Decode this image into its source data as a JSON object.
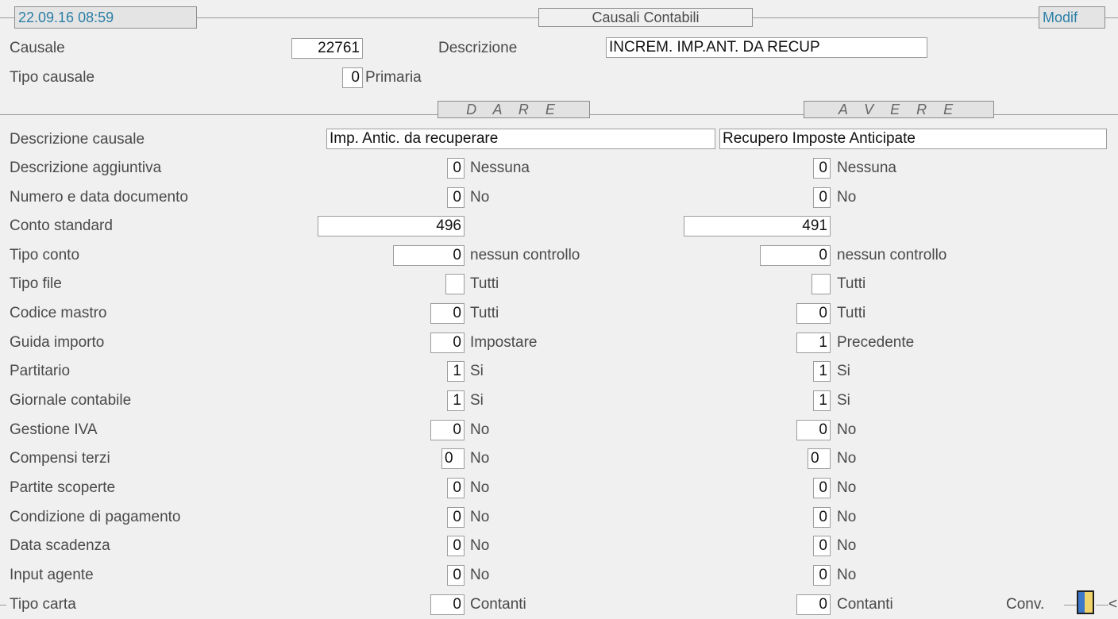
{
  "header": {
    "datetime": "22.09.16 08:59",
    "title": "Causali Contabili",
    "mode": "Modif"
  },
  "causale": {
    "label": "Causale",
    "value": "22761",
    "descrizione_label": "Descrizione",
    "descrizione_value": "INCREM. IMP.ANT. DA RECUP"
  },
  "tipo_causale": {
    "label": "Tipo causale",
    "value": "0",
    "desc": "Primaria"
  },
  "columns": {
    "dare": "D A R E",
    "avere": "A V E R E"
  },
  "rows": {
    "descrizione_causale": {
      "label": "Descrizione causale",
      "dare": "Imp. Antic. da recuperare",
      "avere": "Recupero Imposte Anticipate"
    },
    "descrizione_aggiuntiva": {
      "label": "Descrizione aggiuntiva",
      "dare_value": "0",
      "dare_desc": "Nessuna",
      "avere_value": "0",
      "avere_desc": "Nessuna"
    },
    "numero_data_documento": {
      "label": "Numero e data documento",
      "dare_value": "0",
      "dare_desc": "No",
      "avere_value": "0",
      "avere_desc": "No"
    },
    "conto_standard": {
      "label": "Conto standard",
      "dare_value": "496",
      "avere_value": "491"
    },
    "tipo_conto": {
      "label": "Tipo conto",
      "dare_value": "0",
      "dare_desc": "nessun controllo",
      "avere_value": "0",
      "avere_desc": "nessun controllo"
    },
    "tipo_file": {
      "label": "Tipo file",
      "dare_value": "",
      "dare_desc": "Tutti",
      "avere_value": "",
      "avere_desc": "Tutti"
    },
    "codice_mastro": {
      "label": "Codice mastro",
      "dare_value": "0",
      "dare_desc": "Tutti",
      "avere_value": "0",
      "avere_desc": "Tutti"
    },
    "guida_importo": {
      "label": "Guida importo",
      "dare_value": "0",
      "dare_desc": "Impostare",
      "avere_value": "1",
      "avere_desc": "Precedente"
    },
    "partitario": {
      "label": "Partitario",
      "dare_value": "1",
      "dare_desc": "Si",
      "avere_value": "1",
      "avere_desc": "Si"
    },
    "giornale_contabile": {
      "label": "Giornale contabile",
      "dare_value": "1",
      "dare_desc": "Si",
      "avere_value": "1",
      "avere_desc": "Si"
    },
    "gestione_iva": {
      "label": "Gestione IVA",
      "dare_value": "0",
      "dare_desc": "No",
      "avere_value": "0",
      "avere_desc": "No"
    },
    "compensi_terzi": {
      "label": "Compensi terzi",
      "dare_value": "0",
      "dare_desc": "No",
      "avere_value": "0",
      "avere_desc": "No"
    },
    "partite_scoperte": {
      "label": "Partite scoperte",
      "dare_value": "0",
      "dare_desc": "No",
      "avere_value": "0",
      "avere_desc": "No"
    },
    "condizione_pagamento": {
      "label": "Condizione di pagamento",
      "dare_value": "0",
      "dare_desc": "No",
      "avere_value": "0",
      "avere_desc": "No"
    },
    "data_scadenza": {
      "label": "Data scadenza",
      "dare_value": "0",
      "dare_desc": "No",
      "avere_value": "0",
      "avere_desc": "No"
    },
    "input_agente": {
      "label": "Input agente",
      "dare_value": "0",
      "dare_desc": "No",
      "avere_value": "0",
      "avere_desc": "No"
    },
    "tipo_carta": {
      "label": "Tipo carta",
      "dare_value": "0",
      "dare_desc": "Contanti",
      "avere_value": "0",
      "avere_desc": "Contanti"
    }
  },
  "footer": {
    "conv_label": "Conv.",
    "conv_icon": "conversion-icon",
    "arrow": "<"
  }
}
